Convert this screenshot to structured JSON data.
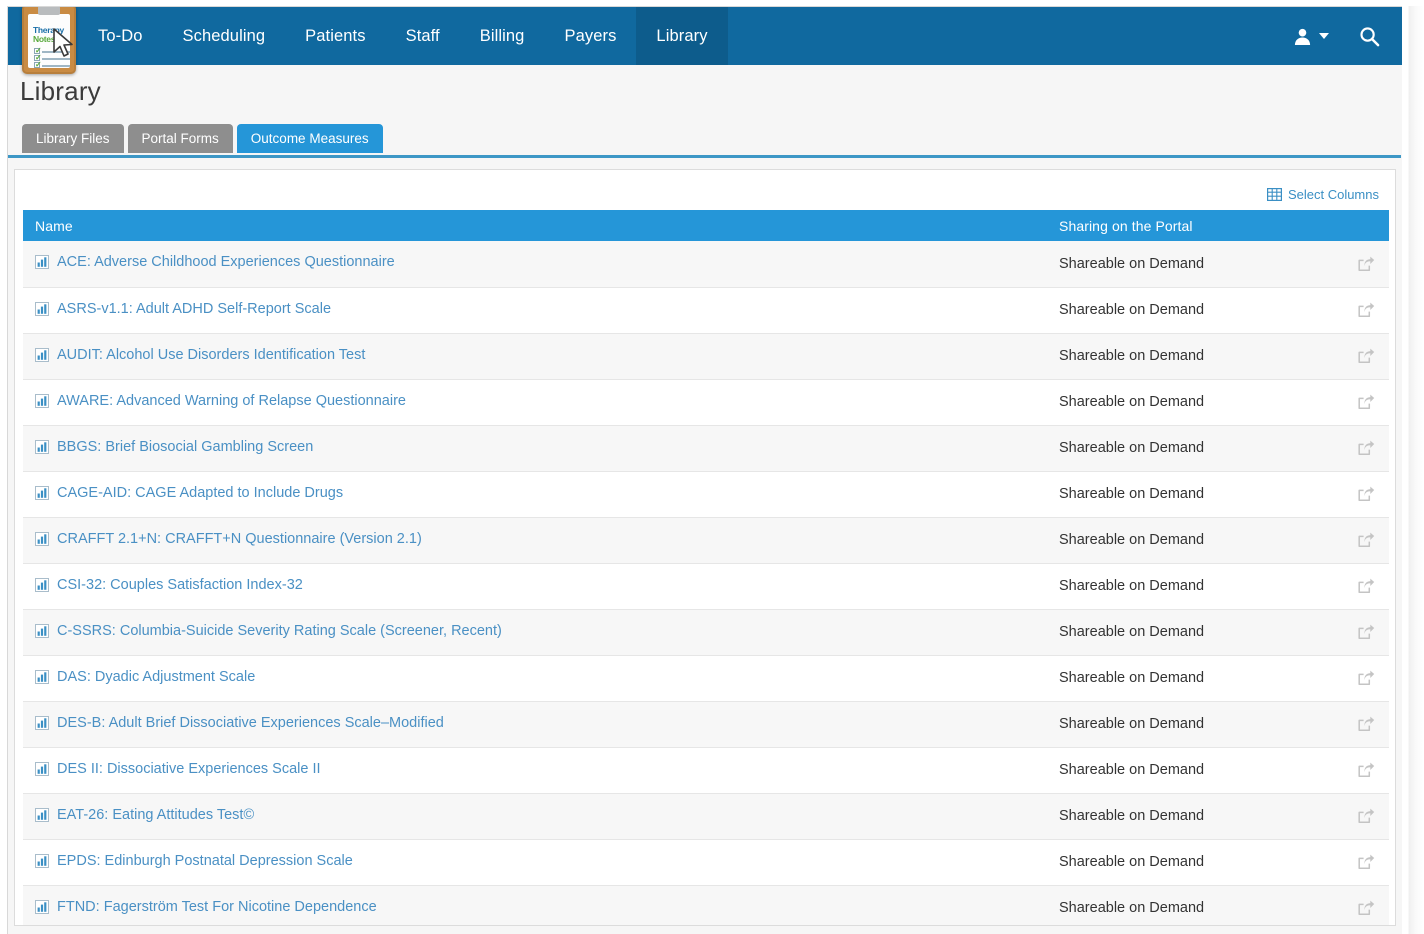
{
  "app": {
    "logo": {
      "name": "therapynotes-logo",
      "line1": "Therapy",
      "line2": "Notes"
    }
  },
  "topnav": {
    "items": [
      {
        "label": "To-Do",
        "active": false
      },
      {
        "label": "Scheduling",
        "active": false
      },
      {
        "label": "Patients",
        "active": false
      },
      {
        "label": "Staff",
        "active": false
      },
      {
        "label": "Billing",
        "active": false
      },
      {
        "label": "Payers",
        "active": false
      },
      {
        "label": "Library",
        "active": true
      }
    ],
    "right_icons": [
      {
        "name": "user-account-icon",
        "glyph": "user-dropdown"
      },
      {
        "name": "search-icon",
        "glyph": "magnifier"
      }
    ]
  },
  "page": {
    "title": "Library"
  },
  "subtabs": [
    {
      "label": "Library Files",
      "active": false
    },
    {
      "label": "Portal Forms",
      "active": false
    },
    {
      "label": "Outcome Measures",
      "active": true
    }
  ],
  "toolbar": {
    "select_columns_label": "Select Columns",
    "select_columns_icon": "grid-icon"
  },
  "table": {
    "columns": [
      {
        "key": "name",
        "label": "Name"
      },
      {
        "key": "sharing",
        "label": "Sharing on the Portal"
      },
      {
        "key": "action",
        "label": ""
      }
    ],
    "row_icon": "bar-chart-icon",
    "action_icon": "share-icon",
    "rows": [
      {
        "name": "ACE: Adverse Childhood Experiences Questionnaire",
        "sharing": "Shareable on Demand"
      },
      {
        "name": "ASRS-v1.1: Adult ADHD Self-Report Scale",
        "sharing": "Shareable on Demand"
      },
      {
        "name": "AUDIT: Alcohol Use Disorders Identification Test",
        "sharing": "Shareable on Demand"
      },
      {
        "name": "AWARE: Advanced Warning of Relapse Questionnaire",
        "sharing": "Shareable on Demand"
      },
      {
        "name": "BBGS: Brief Biosocial Gambling Screen",
        "sharing": "Shareable on Demand"
      },
      {
        "name": "CAGE-AID: CAGE Adapted to Include Drugs",
        "sharing": "Shareable on Demand"
      },
      {
        "name": "CRAFFT 2.1+N: CRAFFT+N Questionnaire (Version 2.1)",
        "sharing": "Shareable on Demand"
      },
      {
        "name": "CSI-32: Couples Satisfaction Index-32",
        "sharing": "Shareable on Demand"
      },
      {
        "name": "C-SSRS: Columbia-Suicide Severity Rating Scale (Screener, Recent)",
        "sharing": "Shareable on Demand"
      },
      {
        "name": "DAS: Dyadic Adjustment Scale",
        "sharing": "Shareable on Demand"
      },
      {
        "name": "DES-B: Adult Brief Dissociative Experiences Scale–Modified",
        "sharing": "Shareable on Demand"
      },
      {
        "name": "DES II: Dissociative Experiences Scale II",
        "sharing": "Shareable on Demand"
      },
      {
        "name": "EAT-26: Eating Attitudes Test©",
        "sharing": "Shareable on Demand"
      },
      {
        "name": "EPDS: Edinburgh Postnatal Depression Scale",
        "sharing": "Shareable on Demand"
      },
      {
        "name": "FTND: Fagerström Test For Nicotine Dependence",
        "sharing": "Shareable on Demand"
      }
    ]
  },
  "colors": {
    "nav_blue": "#10699f",
    "nav_active_blue": "#0d5c8c",
    "accent_blue": "#2596d8",
    "link_blue": "#4a90c4",
    "tab_gray": "#8e8e8e",
    "row_stripe": "#f7f7f7",
    "page_bg": "#f6f6f6"
  }
}
